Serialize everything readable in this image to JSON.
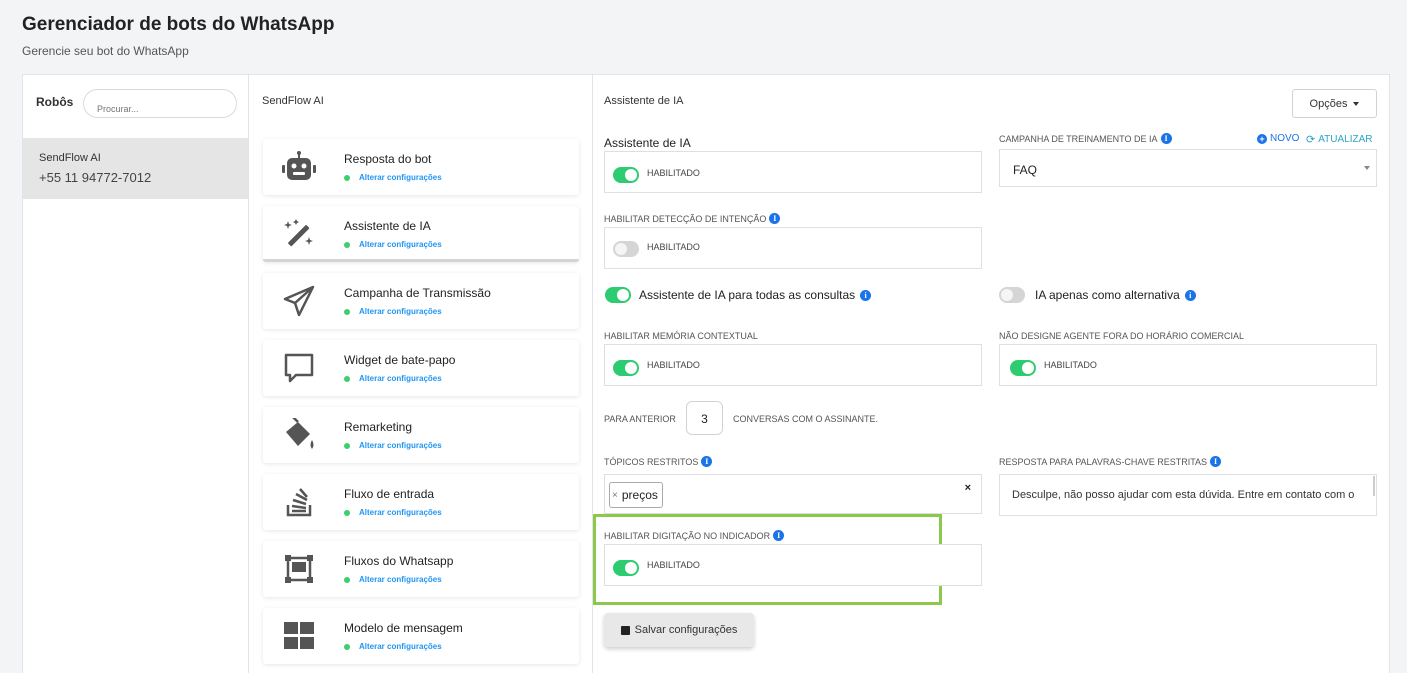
{
  "header": {
    "title": "Gerenciador de bots do WhatsApp",
    "subtitle": "Gerencie seu bot do WhatsApp"
  },
  "robots": {
    "label": "Robôs",
    "search_placeholder": "Procurar...",
    "items": [
      {
        "name": "SendFlow AI",
        "phone": "+55 11 94772-7012"
      }
    ]
  },
  "menu": {
    "header": "SendFlow AI",
    "status_label": "Alterar configurações",
    "items": [
      {
        "title": "Resposta do bot",
        "icon": "robot-icon"
      },
      {
        "title": "Assistente de IA",
        "icon": "magic-wand-icon"
      },
      {
        "title": "Campanha de Transmissão",
        "icon": "paper-plane-icon"
      },
      {
        "title": "Widget de bate-papo",
        "icon": "chat-bubble-icon"
      },
      {
        "title": "Remarketing",
        "icon": "paint-bucket-icon"
      },
      {
        "title": "Fluxo de entrada",
        "icon": "stack-icon"
      },
      {
        "title": "Fluxos do Whatsapp",
        "icon": "flow-icon"
      },
      {
        "title": "Modelo de mensagem",
        "icon": "grid-icon"
      }
    ]
  },
  "settings": {
    "header": "Assistente de IA",
    "options_button": "Opções",
    "ai_assistant": {
      "label": "Assistente de IA",
      "toggle": "HABILITADO",
      "enabled": true
    },
    "training_campaign": {
      "label": "CAMPANHA DE TREINAMENTO DE IA",
      "new_link": "NOVO",
      "refresh_link": "ATUALIZAR",
      "value": "FAQ"
    },
    "intent_detection": {
      "label": "HABILITAR DETECÇÃO DE INTENÇÃO",
      "toggle": "HABILITADO",
      "enabled": false
    },
    "all_queries": {
      "label": "Assistente de IA para todas as consultas",
      "enabled": true
    },
    "fallback_only": {
      "label": "IA apenas como alternativa",
      "enabled": false
    },
    "contextual_memory": {
      "label": "HABILITAR MEMÓRIA CONTEXTUAL",
      "toggle": "HABILITADO",
      "enabled": true
    },
    "after_hours": {
      "label": "NÃO DESIGNE AGENTE FORA DO HORÁRIO COMERCIAL",
      "toggle": "HABILITADO",
      "enabled": true
    },
    "history": {
      "prefix": "PARA ANTERIOR",
      "value": "3",
      "suffix": "CONVERSAS COM O ASSINANTE."
    },
    "restricted_topics": {
      "label": "TÓPICOS RESTRITOS",
      "tags": [
        "preços"
      ]
    },
    "restricted_response": {
      "label": "RESPOSTA PARA PALAVRAS-CHAVE RESTRITAS",
      "value": "Desculpe, não posso ajudar com esta dúvida. Entre em contato com o"
    },
    "typing_indicator": {
      "label": "HABILITAR DIGITAÇÃO NO INDICADOR",
      "toggle": "HABILITADO",
      "enabled": true
    },
    "save_button": "Salvar configurações"
  }
}
